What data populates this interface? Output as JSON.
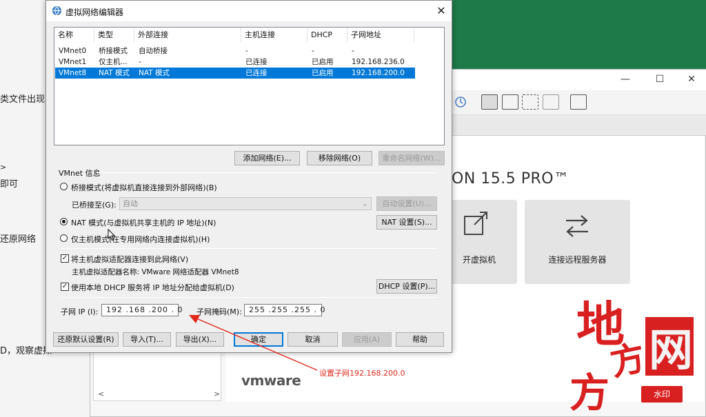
{
  "background_doc": {
    "fragments": [
      "类文件出现",
      ">",
      "即可",
      "还原网络",
      "D，观察虚拟"
    ]
  },
  "vmware": {
    "window_controls": {
      "minimize": "—",
      "maximize": "☐",
      "close": "✕"
    },
    "brand_line": "ON 15.5 PRO™",
    "tiles": {
      "open_vm_label": "开虚拟机",
      "connect_remote_label": "连接远程服务器"
    },
    "logo_text": "vmware",
    "scroll_left": "<",
    "scroll_right": ">"
  },
  "dialog": {
    "title": "虚拟网络编辑器",
    "close": "✕",
    "table": {
      "columns": [
        "名称",
        "类型",
        "外部连接",
        "主机连接",
        "DHCP",
        "子网地址"
      ],
      "rows": [
        [
          "VMnet0",
          "桥接模式",
          "自动桥接",
          "-",
          "-",
          "-"
        ],
        [
          "VMnet1",
          "仅主机...",
          "-",
          "已连接",
          "已启用",
          "192.168.236.0"
        ],
        [
          "VMnet8",
          "NAT 模式",
          "NAT 模式",
          "已连接",
          "已启用",
          "192.168.200.0"
        ]
      ],
      "selected_row": 2
    },
    "buttons_top": {
      "add": "添加网络(E)...",
      "remove": "移除网络(O)",
      "rename": "重命名网络(W)..."
    },
    "group_title": "VMnet 信息",
    "bridge": {
      "radio_label": "桥接模式(将虚拟机直接连接到外部网络)(B)",
      "bridged_to_label": "已桥接至(G):",
      "bridged_to_value": "自动",
      "auto_button": "自动设置(U)..."
    },
    "nat": {
      "radio_label": "NAT 模式(与虚拟机共享主机的 IP 地址)(N)",
      "settings_button": "NAT 设置(S)..."
    },
    "hostonly": {
      "radio_label": "仅主机模式(在专用网络内连接虚拟机)(H)"
    },
    "selected_mode": "nat",
    "connect_adapter": {
      "label": "将主机虚拟适配器连接到此网络(V)",
      "checked": true,
      "adapter_name": "主机虚拟适配器名称: VMware 网络适配器 VMnet8"
    },
    "dhcp": {
      "label": "使用本地 DHCP 服务将 IP 地址分配给虚拟机(D)",
      "checked": true,
      "settings_button": "DHCP 设置(P)..."
    },
    "subnet_ip": {
      "label": "子网 IP (I):",
      "value": "192 .168 .200 . 0"
    },
    "subnet_mask": {
      "label": "子网掩码(M):",
      "value": "255 .255 .255 . 0"
    },
    "buttons_bottom": {
      "restore": "还原默认设置(R)",
      "import": "导入(T)...",
      "export": "导出(X)...",
      "ok": "确定",
      "cancel": "取消",
      "apply": "应用(A)",
      "help": "帮助"
    }
  },
  "annotation": {
    "text": "设置子网192.168.200.0",
    "color": "#e0291c"
  },
  "watermark": {
    "calligraphy": "地方网",
    "badge": "水印"
  },
  "colors": {
    "selection": "#0078d7",
    "green_bg": "#1e7a49",
    "annotation_red": "#e0291c",
    "watermark_red": "#d92020"
  }
}
